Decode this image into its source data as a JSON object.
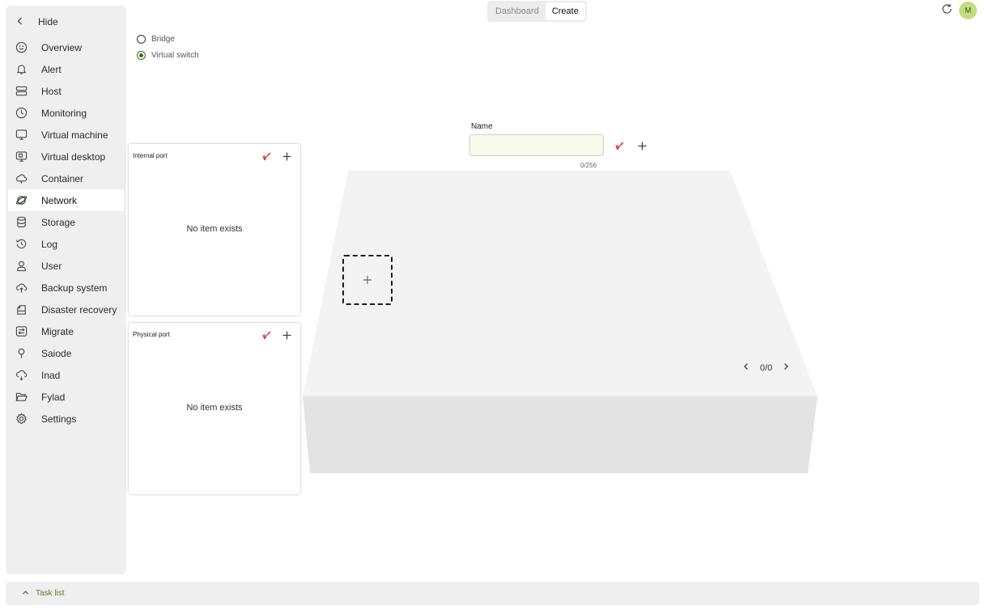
{
  "sidebar": {
    "hide_label": "Hide",
    "items": [
      {
        "label": "Overview",
        "icon": "smile-icon"
      },
      {
        "label": "Alert",
        "icon": "bell-icon"
      },
      {
        "label": "Host",
        "icon": "server-icon"
      },
      {
        "label": "Monitoring",
        "icon": "clock-icon"
      },
      {
        "label": "Virtual machine",
        "icon": "monitor-icon"
      },
      {
        "label": "Virtual desktop",
        "icon": "desktop-icon"
      },
      {
        "label": "Container",
        "icon": "cloud-icon"
      },
      {
        "label": "Network",
        "icon": "planet-icon",
        "active": true
      },
      {
        "label": "Storage",
        "icon": "database-icon"
      },
      {
        "label": "Log",
        "icon": "history-icon"
      },
      {
        "label": "User",
        "icon": "user-icon"
      },
      {
        "label": "Backup system",
        "icon": "cloud-upload-icon"
      },
      {
        "label": "Disaster recovery",
        "icon": "recovery-icon"
      },
      {
        "label": "Migrate",
        "icon": "migrate-icon"
      },
      {
        "label": "Saiode",
        "icon": "pin-icon"
      },
      {
        "label": "Inad",
        "icon": "cloud-sync-icon"
      },
      {
        "label": "Fylad",
        "icon": "folder-icon"
      },
      {
        "label": "Settings",
        "icon": "gear-icon"
      }
    ]
  },
  "header": {
    "tabs": [
      {
        "label": "Dashboard",
        "active": false
      },
      {
        "label": "Create",
        "active": true
      }
    ],
    "avatar_initial": "M"
  },
  "type_options": [
    {
      "label": "Bridge",
      "selected": false
    },
    {
      "label": "Virtual switch",
      "selected": true
    }
  ],
  "name_field": {
    "label": "Name",
    "value": "",
    "counter": "0/256"
  },
  "internal_port": {
    "title": "Internal port",
    "empty_text": "No item exists"
  },
  "physical_port": {
    "title": "Physical port",
    "empty_text": "No item exists"
  },
  "switch_stage": {
    "pager": "0/0"
  },
  "footer": {
    "task_list_label": "Task list"
  },
  "colors": {
    "accent": "#3f6b1e",
    "clear_red": "#d23a3a",
    "sidebar_bg": "#efefef",
    "input_bg": "#f9f9ec"
  }
}
